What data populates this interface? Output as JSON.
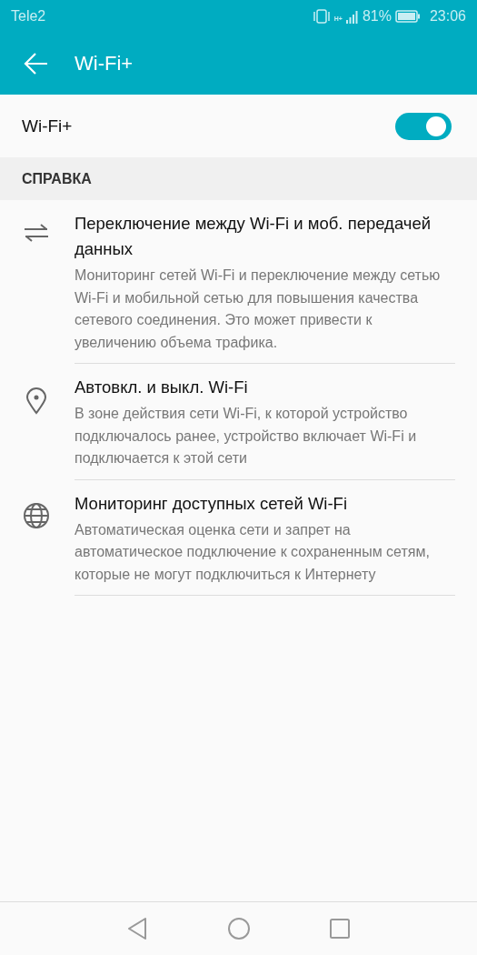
{
  "status_bar": {
    "carrier": "Tele2",
    "network": "H+",
    "battery": "81%",
    "time": "23:06"
  },
  "app_bar": {
    "title": "Wi-Fi+"
  },
  "toggle": {
    "label": "Wi-Fi+",
    "on": true
  },
  "section": {
    "title": "СПРАВКА"
  },
  "items": [
    {
      "kind": "swap",
      "title": "Переключение между Wi-Fi и моб. передачей данных",
      "description": "Мониторинг сетей Wi-Fi и переключение между сетью Wi-Fi и мобильной сетью для повышения качества сетевого соединения. Это может привести к увеличению объема трафика."
    },
    {
      "kind": "location",
      "title": "Автовкл. и выкл. Wi-Fi",
      "description": "В зоне действия сети Wi-Fi, к которой устройство подключалось ранее, устройство включает Wi-Fi и подключается к этой сети"
    },
    {
      "kind": "globe",
      "title": "Мониторинг доступных сетей Wi-Fi",
      "description": "Автоматическая оценка сети и запрет на автоматическое подключение к сохраненным сетям, которые не могут подключиться к Интернету"
    }
  ]
}
